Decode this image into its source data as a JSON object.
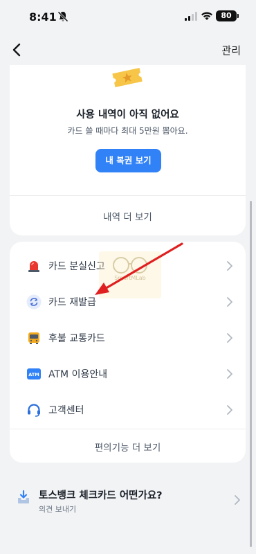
{
  "status_bar": {
    "time": "8:41",
    "battery": "80"
  },
  "nav": {
    "manage_label": "관리"
  },
  "empty_state": {
    "title": "사용 내역이 아직 없어요",
    "subtitle": "카드 쓸 때마다 최대 5만원 뽑아요.",
    "button_label": "내 복권 보기",
    "more_history_label": "내역 더 보기"
  },
  "menu": {
    "items": [
      {
        "label": "카드 분실신고",
        "icon": "siren-icon"
      },
      {
        "label": "카드 재발급",
        "icon": "reissue-icon"
      },
      {
        "label": "후불 교통카드",
        "icon": "bus-icon"
      },
      {
        "label": "ATM 이용안내",
        "icon": "atm-icon"
      },
      {
        "label": "고객센터",
        "icon": "headset-icon"
      }
    ],
    "more_features_label": "편의기능 더 보기"
  },
  "feedback": {
    "title": "토스뱅크 체크카드 어떤가요?",
    "subtitle": "의견 보내기"
  },
  "watermark": {
    "text": "SmartMLab"
  },
  "colors": {
    "accent": "#3182f6",
    "background": "#f2f3f5",
    "arrow": "#e02020"
  }
}
